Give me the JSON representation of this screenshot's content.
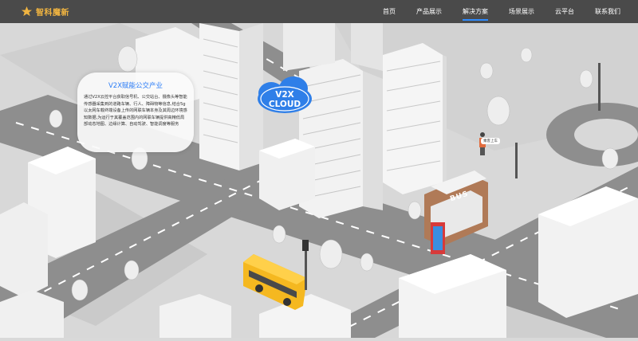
{
  "header": {
    "logo_text": "智科魔新",
    "nav": [
      {
        "label": "首页",
        "active": false
      },
      {
        "label": "产品展示",
        "active": false
      },
      {
        "label": "解决方案",
        "active": true
      },
      {
        "label": "场景展示",
        "active": false
      },
      {
        "label": "云平台",
        "active": false
      },
      {
        "label": "联系我们",
        "active": false
      }
    ]
  },
  "info_panel": {
    "title": "V2X赋能公交产业",
    "body": "通过V2X云控平台获取信号机、公交站台、摄像头等智能传感器采集到的道路车辆、行人、障碍物等信息,结合5g以太网车载终端设备上传的网联车辆本身及其周边环境感知数据,为运行于其覆盖范围内的网联车辆提供高精低局部动态地图、边缘计算、自动驾驶、智能调度等服务"
  },
  "scene": {
    "cloud_label": "V2X CLOUD",
    "bus_stop_sign": "BUS",
    "person_tag": "乘客上车"
  },
  "colors": {
    "accent": "#2e8bff",
    "logo": "#f0b441",
    "bus_yellow": "#f5b820",
    "bus_stop_brown": "#b07a57",
    "cloud_blue": "#2f7fe8"
  }
}
